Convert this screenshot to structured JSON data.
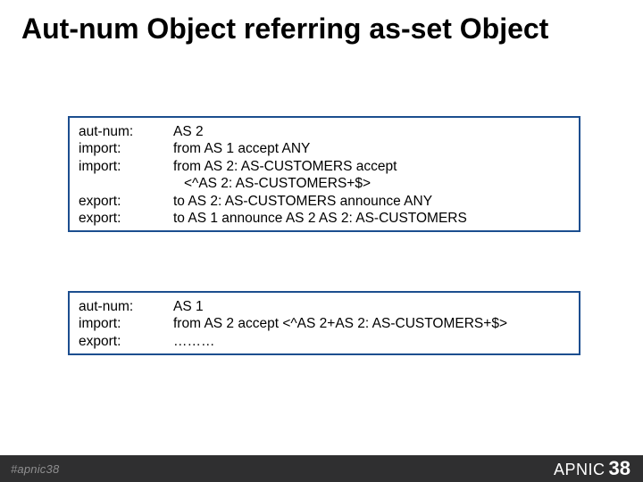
{
  "title": "Aut-num Object referring as-set Object",
  "box1": {
    "rows": [
      {
        "k": "aut-num:",
        "v": " AS 2"
      },
      {
        "k": "import:",
        "v": "from AS 1 accept ANY"
      },
      {
        "k": "import:",
        "v": "from AS 2: AS-CUSTOMERS accept"
      },
      {
        "k": "",
        "v": "<^AS 2: AS-CUSTOMERS+$>",
        "indent": true
      },
      {
        "k": "export:",
        "v": "to AS 2: AS-CUSTOMERS announce ANY"
      },
      {
        "k": "export:",
        "v": "to AS 1 announce AS 2 AS 2: AS-CUSTOMERS"
      }
    ]
  },
  "box2": {
    "rows": [
      {
        "k": "aut-num:",
        "v": " AS 1"
      },
      {
        "k": "import:",
        "v": "from AS 2 accept <^AS 2+AS 2: AS-CUSTOMERS+$>"
      },
      {
        "k": "export:",
        "v": "………"
      }
    ]
  },
  "footer": {
    "hashtag": "#apnic38",
    "brand_name": "APNIC",
    "brand_num": "38"
  }
}
